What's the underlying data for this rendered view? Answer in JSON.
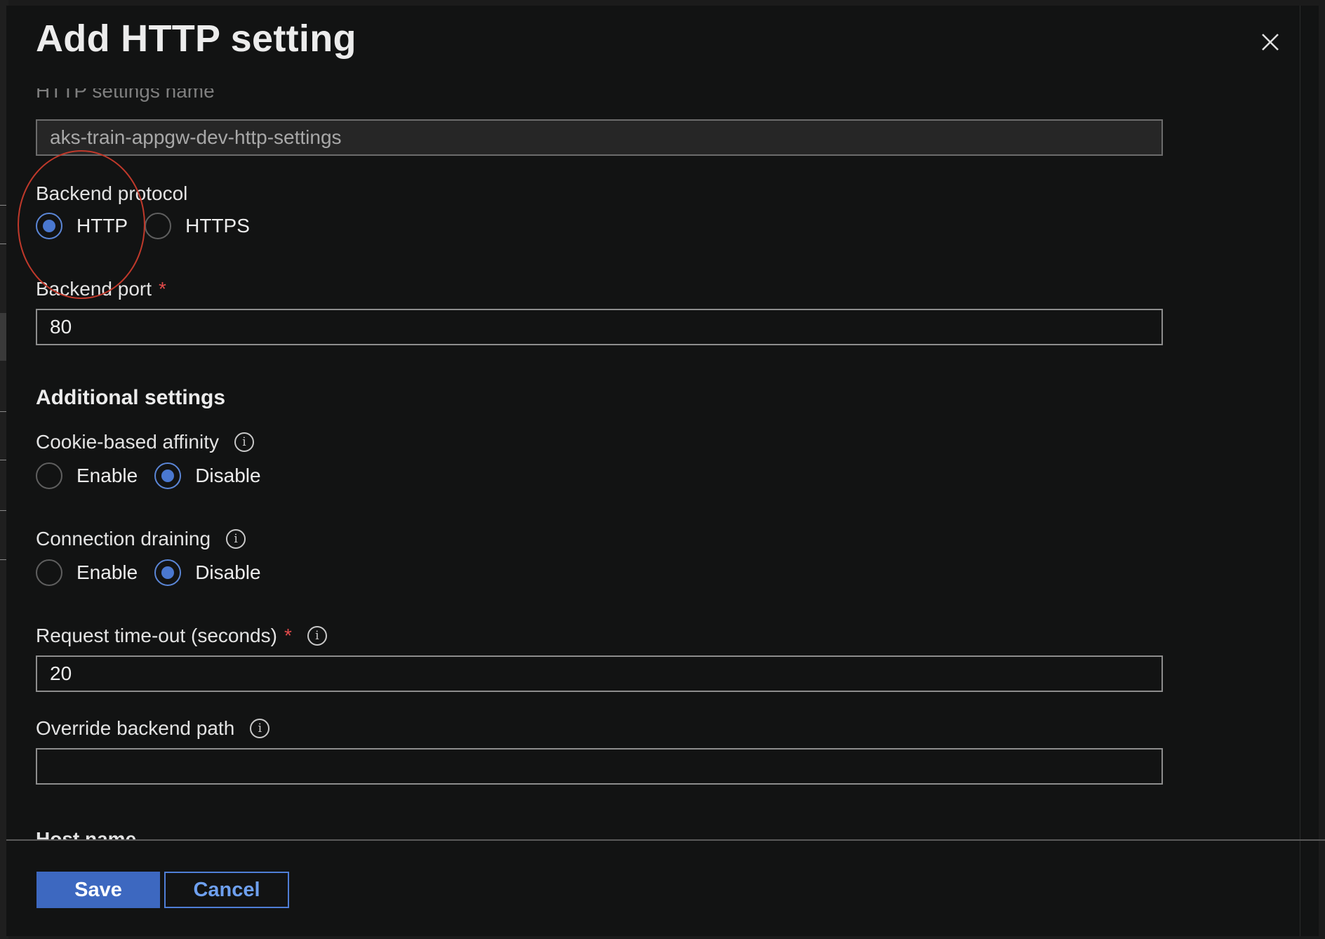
{
  "dialog": {
    "title": "Add HTTP setting"
  },
  "fields": {
    "settings_name": {
      "label": "HTTP settings name",
      "value": "aks-train-appgw-dev-http-settings"
    },
    "backend_protocol": {
      "label": "Backend protocol",
      "options": [
        "HTTP",
        "HTTPS"
      ],
      "selected": "HTTP"
    },
    "backend_port": {
      "label": "Backend port",
      "required_mark": "*",
      "value": "80"
    },
    "additional_settings": {
      "heading": "Additional settings"
    },
    "cookie_affinity": {
      "label": "Cookie-based affinity",
      "info_icon": "i",
      "options": [
        "Enable",
        "Disable"
      ],
      "selected": "Disable"
    },
    "connection_draining": {
      "label": "Connection draining",
      "info_icon": "i",
      "options": [
        "Enable",
        "Disable"
      ],
      "selected": "Disable"
    },
    "request_timeout": {
      "label": "Request time-out (seconds)",
      "required_mark": "*",
      "info_icon": "i",
      "value": "20"
    },
    "override_path": {
      "label": "Override backend path",
      "info_icon": "i",
      "value": ""
    },
    "host_name": {
      "label": "Host name"
    }
  },
  "footer": {
    "save_label": "Save",
    "cancel_label": "Cancel"
  },
  "colors": {
    "accent": "#4a78d0",
    "required": "#e24a4a",
    "annotation": "#c0392b"
  },
  "icons": {
    "close": "close-icon",
    "info": "info-icon"
  }
}
